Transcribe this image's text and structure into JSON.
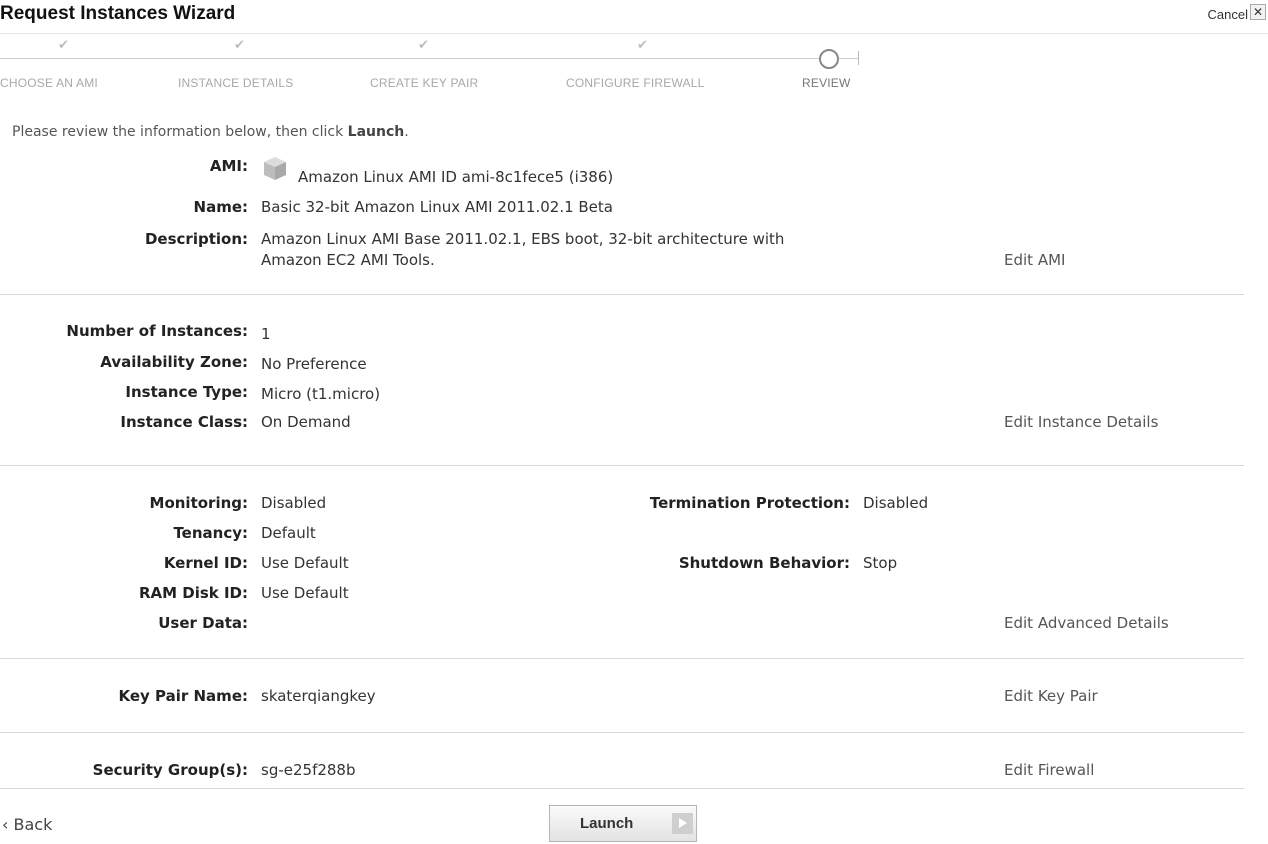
{
  "window": {
    "title": "Request Instances Wizard",
    "cancel_label": "Cancel",
    "close_glyph": "✕"
  },
  "steps": [
    {
      "label": "CHOOSE AN AMI",
      "status": "completed",
      "check": "✔"
    },
    {
      "label": "INSTANCE DETAILS",
      "status": "completed",
      "check": "✔"
    },
    {
      "label": "CREATE KEY PAIR",
      "status": "completed",
      "check": "✔"
    },
    {
      "label": "CONFIGURE FIREWALL",
      "status": "completed",
      "check": "✔"
    },
    {
      "label": "REVIEW",
      "status": "current"
    }
  ],
  "intro": {
    "before": "Please review the information below, then click ",
    "action": "Launch",
    "after": "."
  },
  "ami_section": {
    "ami_label": "AMI:",
    "ami_icon": "cube-icon",
    "ami_value": "Amazon Linux AMI ID ami-8c1fece5 (i386)",
    "name_label": "Name:",
    "name_value": "Basic 32-bit Amazon Linux AMI 2011.02.1 Beta",
    "description_label": "Description:",
    "description_line1": "Amazon Linux AMI Base 2011.02.1, EBS boot, 32-bit architecture with",
    "description_line2": "Amazon EC2 AMI Tools.",
    "edit_label": "Edit AMI"
  },
  "instance_section": {
    "count_label": "Number of Instances:",
    "count_value": "1",
    "zone_label": "Availability Zone:",
    "zone_value": "No Preference",
    "type_label": "Instance Type:",
    "type_value": "Micro (t1.micro)",
    "class_label": "Instance Class:",
    "class_value": "On Demand",
    "edit_label": "Edit Instance Details"
  },
  "advanced_section": {
    "monitoring_label": "Monitoring:",
    "monitoring_value": "Disabled",
    "tenancy_label": "Tenancy:",
    "tenancy_value": "Default",
    "kernel_label": "Kernel ID:",
    "kernel_value": "Use Default",
    "ramdisk_label": "RAM Disk ID:",
    "ramdisk_value": "Use Default",
    "userdata_label": "User Data:",
    "termination_label": "Termination Protection:",
    "termination_value": "Disabled",
    "shutdown_label": "Shutdown Behavior:",
    "shutdown_value": "Stop",
    "edit_label": "Edit Advanced Details"
  },
  "keypair_section": {
    "label": "Key Pair Name:",
    "value": "skaterqiangkey",
    "edit_label": "Edit Key Pair"
  },
  "firewall_section": {
    "label": "Security Group(s):",
    "value": "sg-e25f288b",
    "edit_label": "Edit Firewall"
  },
  "footer": {
    "back_label": "‹ Back",
    "launch_label": "Launch",
    "launch_icon": "play-arrow-icon"
  }
}
